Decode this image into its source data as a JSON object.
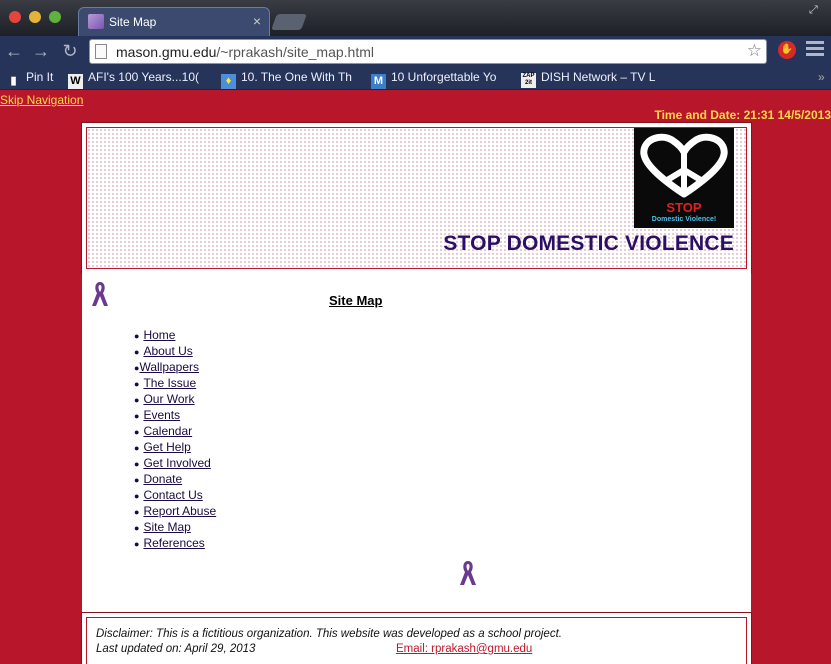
{
  "browser": {
    "tab_title": "Site Map",
    "url_host": "mason.gmu.edu",
    "url_path": "/~rprakash/site_map.html",
    "bookmarks": [
      {
        "label": "Pin It",
        "icon": "pin-icon"
      },
      {
        "label": "AFI's 100 Years...10(",
        "icon": "wikipedia-icon"
      },
      {
        "label": "10. The One With Th",
        "icon": "tv-icon"
      },
      {
        "label": "10 Unforgettable Yo",
        "icon": "m-icon"
      },
      {
        "label": "DISH Network – TV L",
        "icon": "zap2it-icon"
      }
    ]
  },
  "page": {
    "skip_navigation": "Skip Navigation",
    "datetime": "Time and Date: 21:31 14/5/2013",
    "banner": {
      "logo_stop": "STOP",
      "logo_sub": "Domestic Violence!",
      "title": "STOP DOMESTIC VIOLENCE"
    },
    "title": "Site Map",
    "links": [
      "Home",
      "About Us",
      "Wallpapers",
      "The Issue",
      "Our Work",
      "Events",
      "Calendar",
      "Get Help",
      "Get Involved",
      "Donate",
      "Contact Us",
      "Report Abuse",
      "Site Map",
      "References"
    ],
    "footer": {
      "disclaimer": "Disclaimer: This is a fictitious organization. This website was developed as a school project.",
      "updated": "Last updated on: April 29, 2013",
      "email": "Email: rprakash@gmu.edu"
    }
  },
  "colors": {
    "page_bg": "#b8162a",
    "banner_title": "#2c0e66",
    "highlight": "#ffd84a"
  }
}
